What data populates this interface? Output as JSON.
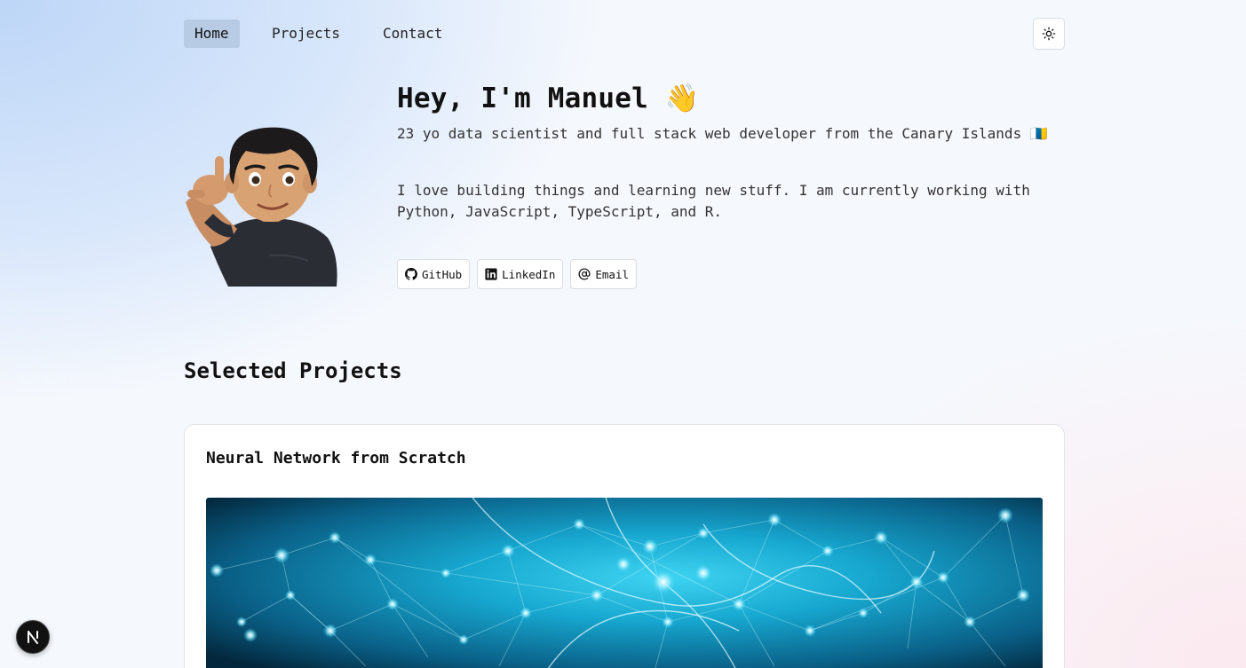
{
  "nav": {
    "items": [
      {
        "label": "Home",
        "active": true
      },
      {
        "label": "Projects",
        "active": false
      },
      {
        "label": "Contact",
        "active": false
      }
    ],
    "theme_toggle_icon": "sun-icon"
  },
  "hero": {
    "title": "Hey, I'm Manuel 👋",
    "subtitle": "23 yo data scientist and full stack web developer from the Canary Islands 🇮🇨",
    "bio": "I love building things and learning new stuff. I am currently working with Python, JavaScript, TypeScript, and R.",
    "avatar_icon": "memoji-avatar",
    "socials": [
      {
        "label": "GitHub",
        "icon": "github-icon"
      },
      {
        "label": "LinkedIn",
        "icon": "linkedin-icon"
      },
      {
        "label": "Email",
        "icon": "at-sign-icon"
      }
    ]
  },
  "projects": {
    "heading": "Selected Projects",
    "items": [
      {
        "title": "Neural Network from Scratch",
        "image_icon": "neural-network-image"
      }
    ]
  },
  "dev_badge": {
    "icon": "nextjs-icon",
    "letter": "N"
  },
  "colors": {
    "active_nav_bg": "#b7cbe4",
    "image_cyan": "#29c6ea",
    "image_dark": "#04314a"
  }
}
